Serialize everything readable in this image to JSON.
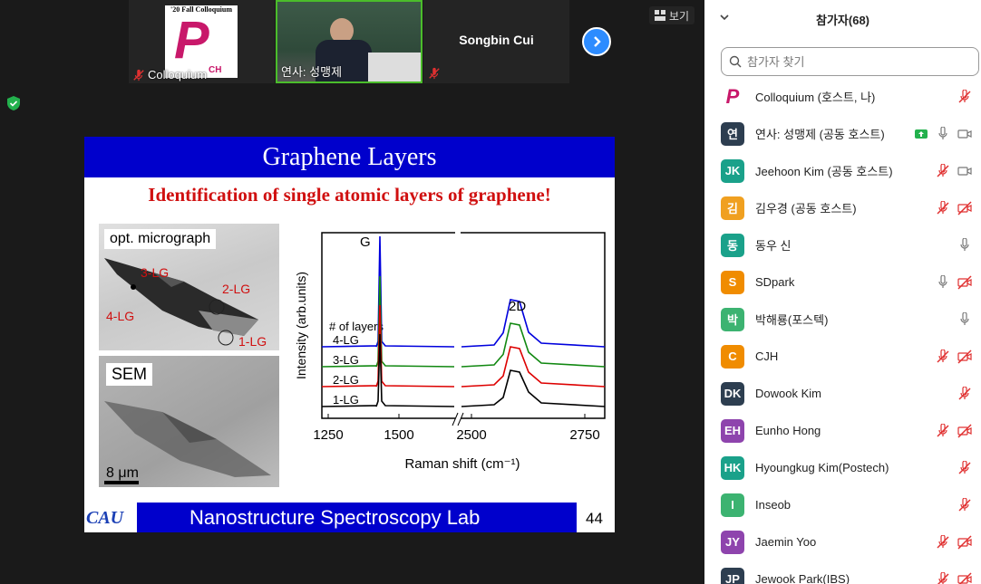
{
  "thumbnails": [
    {
      "name": "Colloquium",
      "muted": true
    },
    {
      "name": "연사: 성맹제",
      "muted": true
    },
    {
      "name": "Songbin Cui",
      "muted": false
    }
  ],
  "logo_caption": "'20 Fall Colloquium",
  "logo_letter": "P",
  "logo_sub": "CH",
  "view_button": "보기",
  "slide": {
    "title": "Graphene Layers",
    "subtitle": "Identification of single atomic layers of graphene!",
    "micro_label": "opt. micrograph",
    "sem_label": "SEM",
    "scale_label": "8 μm",
    "layer_labels": [
      "3-LG",
      "2-LG",
      "4-LG",
      "1-LG"
    ],
    "footer": "Nanostructure Spectroscopy Lab",
    "page_number": "44",
    "logo_text": "CAU"
  },
  "chart_data": {
    "type": "line",
    "xlabel": "Raman shift (cm⁻¹)",
    "ylabel": "Intensity (arb.units)",
    "x_ticks": [
      "1250",
      "1500",
      "2500",
      "2750"
    ],
    "legend_title": "# of layers",
    "peak_labels": [
      "G",
      "2D"
    ],
    "series": [
      {
        "name": "4-LG",
        "color": "#0000dd"
      },
      {
        "name": "3-LG",
        "color": "#118811"
      },
      {
        "name": "2-LG",
        "color": "#dd0000"
      },
      {
        "name": "1-LG",
        "color": "#000000"
      }
    ]
  },
  "panel": {
    "title": "참가자(68)",
    "search_placeholder": "참가자 찾기",
    "participants": [
      {
        "initials": "P",
        "name": "Colloquium (호스트, 나)",
        "color": "#ffffff",
        "icons": [
          "mic-off"
        ]
      },
      {
        "initials": "연",
        "name": "연사: 성맹제 (공동 호스트)",
        "color": "#2d3e50",
        "icons": [
          "share-green",
          "mic",
          "video"
        ]
      },
      {
        "initials": "JK",
        "name": "Jeehoon Kim (공동 호스트)",
        "color": "#1aa18a",
        "icons": [
          "mic-off",
          "video"
        ]
      },
      {
        "initials": "김",
        "name": "김우경 (공동 호스트)",
        "color": "#f0a020",
        "icons": [
          "mic-off",
          "video-off"
        ]
      },
      {
        "initials": "동",
        "name": "동우 신",
        "color": "#1aa18a",
        "icons": [
          "mic"
        ]
      },
      {
        "initials": "S",
        "name": "SDpark",
        "color": "#f08c00",
        "icons": [
          "mic",
          "video-off"
        ]
      },
      {
        "initials": "박",
        "name": "박해룡(포스텍)",
        "color": "#3cb371",
        "icons": [
          "mic"
        ]
      },
      {
        "initials": "C",
        "name": "CJH",
        "color": "#f08c00",
        "icons": [
          "mic-off",
          "video-off"
        ]
      },
      {
        "initials": "DK",
        "name": "Dowook Kim",
        "color": "#2d3e50",
        "icons": [
          "mic-off"
        ]
      },
      {
        "initials": "EH",
        "name": "Eunho Hong",
        "color": "#8e44ad",
        "icons": [
          "mic-off",
          "video-off"
        ]
      },
      {
        "initials": "HK",
        "name": "Hyoungkug Kim(Postech)",
        "color": "#1aa18a",
        "icons": [
          "mic-off"
        ]
      },
      {
        "initials": "I",
        "name": "Inseob",
        "color": "#3cb371",
        "icons": [
          "mic-off"
        ]
      },
      {
        "initials": "JY",
        "name": "Jaemin Yoo",
        "color": "#8e44ad",
        "icons": [
          "mic-off",
          "video-off"
        ]
      },
      {
        "initials": "JP",
        "name": "Jewook Park(IBS)",
        "color": "#2d3e50",
        "icons": [
          "mic-off",
          "video-off"
        ]
      }
    ]
  }
}
